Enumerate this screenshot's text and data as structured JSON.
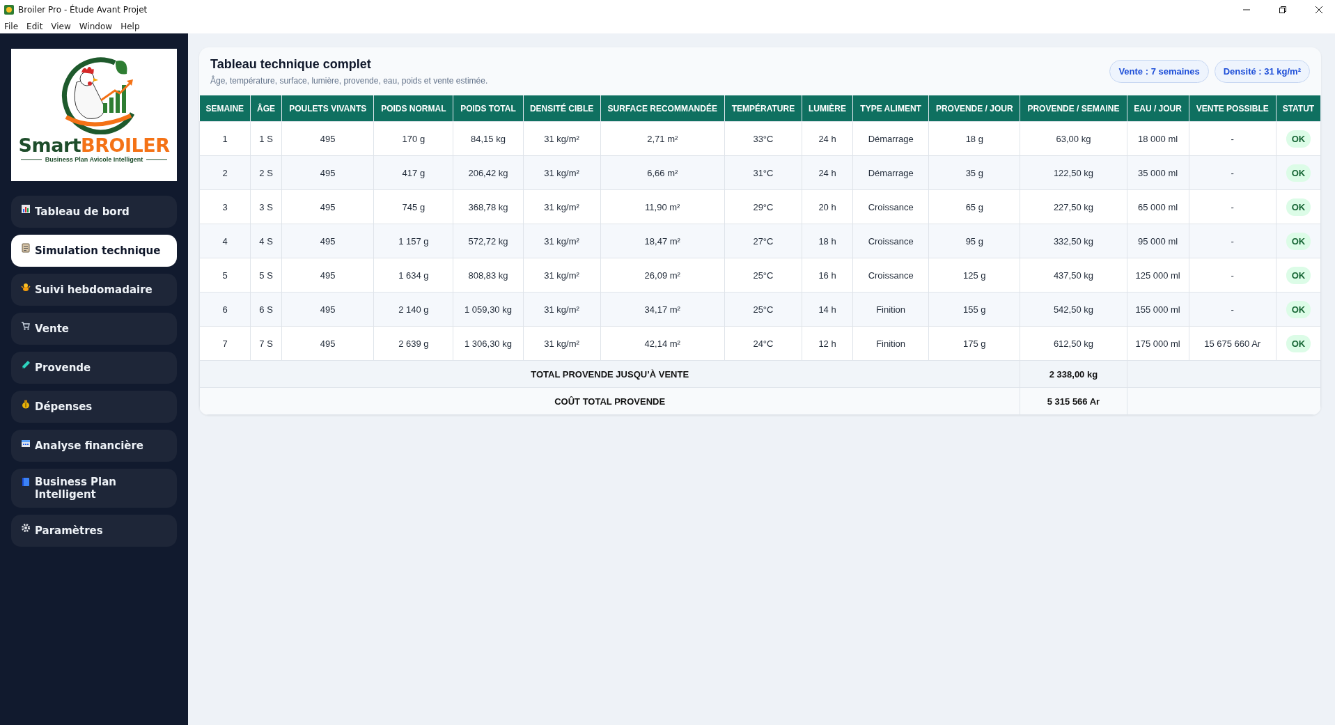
{
  "window": {
    "title": "Broiler Pro - Étude Avant Projet"
  },
  "menu": [
    "File",
    "Edit",
    "View",
    "Window",
    "Help"
  ],
  "sidebar": {
    "logo": {
      "brand_first": "Smart",
      "brand_second": "BROILER",
      "tagline": "Business Plan Avicole Intelligent"
    },
    "items": [
      {
        "label": "Tableau de bord",
        "selected": false
      },
      {
        "label": "Simulation technique",
        "selected": true
      },
      {
        "label": "Suivi hebdomadaire",
        "selected": false
      },
      {
        "label": "Vente",
        "selected": false
      },
      {
        "label": "Provende",
        "selected": false
      },
      {
        "label": "Dépenses",
        "selected": false
      },
      {
        "label": "Analyse financière",
        "selected": false
      },
      {
        "label": "Business Plan Intelligent",
        "selected": false
      },
      {
        "label": "Paramètres",
        "selected": false
      }
    ]
  },
  "card": {
    "title": "Tableau technique complet",
    "subtitle": "Âge, température, surface, lumière, provende, eau, poids et vente estimée.",
    "pills": [
      "Vente : 7 semaines",
      "Densité : 31 kg/m²"
    ]
  },
  "table": {
    "columns": [
      "SEMAINE",
      "ÂGE",
      "POULETS VIVANTS",
      "POIDS NORMAL",
      "POIDS TOTAL",
      "DENSITÉ CIBLE",
      "SURFACE RECOMMANDÉE",
      "TEMPÉRATURE",
      "LUMIÈRE",
      "TYPE ALIMENT",
      "PROVENDE / JOUR",
      "PROVENDE / SEMAINE",
      "EAU / JOUR",
      "VENTE POSSIBLE",
      "STATUT"
    ],
    "rows": [
      [
        "1",
        "1 S",
        "495",
        "170 g",
        "84,15 kg",
        "31 kg/m²",
        "2,71 m²",
        "33°C",
        "24 h",
        "Démarrage",
        "18 g",
        "63,00 kg",
        "18 000 ml",
        "-",
        "OK"
      ],
      [
        "2",
        "2 S",
        "495",
        "417 g",
        "206,42 kg",
        "31 kg/m²",
        "6,66 m²",
        "31°C",
        "24 h",
        "Démarrage",
        "35 g",
        "122,50 kg",
        "35 000 ml",
        "-",
        "OK"
      ],
      [
        "3",
        "3 S",
        "495",
        "745 g",
        "368,78 kg",
        "31 kg/m²",
        "11,90 m²",
        "29°C",
        "20 h",
        "Croissance",
        "65 g",
        "227,50 kg",
        "65 000 ml",
        "-",
        "OK"
      ],
      [
        "4",
        "4 S",
        "495",
        "1 157 g",
        "572,72 kg",
        "31 kg/m²",
        "18,47 m²",
        "27°C",
        "18 h",
        "Croissance",
        "95 g",
        "332,50 kg",
        "95 000 ml",
        "-",
        "OK"
      ],
      [
        "5",
        "5 S",
        "495",
        "1 634 g",
        "808,83 kg",
        "31 kg/m²",
        "26,09 m²",
        "25°C",
        "16 h",
        "Croissance",
        "125 g",
        "437,50 kg",
        "125 000 ml",
        "-",
        "OK"
      ],
      [
        "6",
        "6 S",
        "495",
        "2 140 g",
        "1 059,30 kg",
        "31 kg/m²",
        "34,17 m²",
        "25°C",
        "14 h",
        "Finition",
        "155 g",
        "542,50 kg",
        "155 000 ml",
        "-",
        "OK"
      ],
      [
        "7",
        "7 S",
        "495",
        "2 639 g",
        "1 306,30 kg",
        "31 kg/m²",
        "42,14 m²",
        "24°C",
        "12 h",
        "Finition",
        "175 g",
        "612,50 kg",
        "175 000 ml",
        "15 675 660 Ar",
        "OK"
      ]
    ],
    "totals": [
      {
        "label": "TOTAL PROVENDE JUSQU’À VENTE",
        "value": "2 338,00 kg"
      },
      {
        "label": "COÛT TOTAL PROVENDE",
        "value": "5 315 566 Ar"
      }
    ]
  }
}
